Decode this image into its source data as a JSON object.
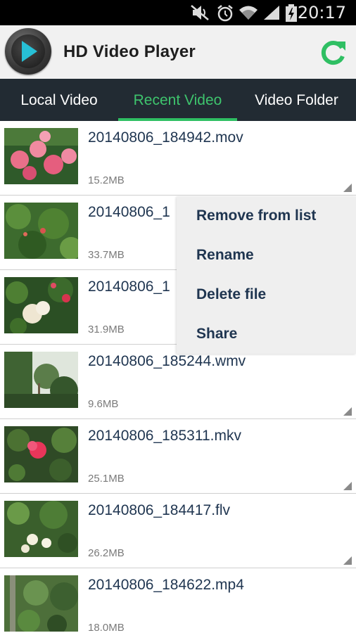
{
  "status_bar": {
    "time": "20:17",
    "icons": [
      "mute-icon",
      "alarm-icon",
      "wifi-icon",
      "signal-icon",
      "battery-charging-icon"
    ]
  },
  "app_header": {
    "title": "HD Video Player",
    "icons": [
      "app-logo-play-icon",
      "refresh-icon"
    ],
    "colors": {
      "accent": "#2fbf63",
      "logo_play": "#27c0d6"
    }
  },
  "tabs": [
    {
      "label": "Local Video",
      "active": false
    },
    {
      "label": "Recent Video",
      "active": true
    },
    {
      "label": "Video Folder",
      "active": false
    }
  ],
  "videos": [
    {
      "name": "20140806_184942.mov",
      "size": "15.2MB"
    },
    {
      "name": "20140806_1",
      "size": "33.7MB"
    },
    {
      "name": "20140806_1",
      "size": "31.9MB"
    },
    {
      "name": "20140806_185244.wmv",
      "size": "9.6MB"
    },
    {
      "name": "20140806_185311.mkv",
      "size": "25.1MB"
    },
    {
      "name": "20140806_184417.flv",
      "size": "26.2MB"
    },
    {
      "name": "20140806_184622.mp4",
      "size": "18.0MB"
    }
  ],
  "context_menu": {
    "items": [
      "Remove from list",
      "Rename",
      "Delete file",
      "Share"
    ]
  }
}
